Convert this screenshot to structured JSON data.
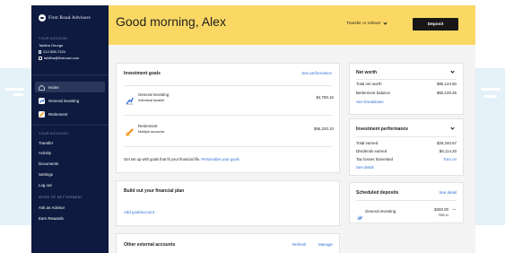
{
  "brand": {
    "name": "First Road Advisors"
  },
  "sidebar": {
    "advisor_heading": "YOUR ADVISOR",
    "advisor_name": "Tabitha George",
    "advisor_phone": "212-555-7224",
    "advisor_email": "tabitha@firstroad.com",
    "nav": [
      {
        "label": "Home"
      },
      {
        "label": "General investing"
      },
      {
        "label": "Retirement"
      }
    ],
    "account_heading": "YOUR ACCOUNT",
    "account_items": [
      "Transfer",
      "Activity",
      "Documents",
      "Settings",
      "Log out"
    ],
    "more_heading": "MORE OF BETTERMENT",
    "more_items": [
      "Ask an Advisor",
      "Earn Rewards"
    ]
  },
  "header": {
    "greeting": "Good morning, Alex",
    "transfer_label": "Transfer or rollover",
    "deposit_label": "Deposit"
  },
  "goals": {
    "title": "Investment goals",
    "link": "See performance",
    "items": [
      {
        "name": "General investing",
        "sub": "Individual taxable",
        "value": "$4,780.15"
      },
      {
        "name": "Retirement",
        "sub": "Multiple accounts",
        "value": "$55,320.10"
      }
    ],
    "footer_text": "Get set up with goals that fit your financial life.",
    "footer_link": "Personalize your goals"
  },
  "plan": {
    "title": "Build out your financial plan",
    "link": "Add goal/account"
  },
  "external": {
    "title": "Other external accounts",
    "refresh": "Refresh",
    "manage": "Manage"
  },
  "networth": {
    "title": "Net worth",
    "rows": [
      {
        "label": "Total net worth",
        "value": "$85,124.50"
      },
      {
        "label": "Betterment balance",
        "value": "$60,100.25"
      }
    ],
    "link": "See breakdown"
  },
  "performance": {
    "title": "Investment performance",
    "rows": [
      {
        "label": "Total earned",
        "value": "$26,340.67"
      },
      {
        "label": "Dividends earned",
        "value": "$8,114.20"
      },
      {
        "label": "Tax losses harvested",
        "value": "Turn on"
      }
    ],
    "link": "See detail"
  },
  "scheduled": {
    "title": "Scheduled deposits",
    "link": "See detail",
    "item": {
      "name": "General investing",
      "amount": "$300.00",
      "date": "FEB 11",
      "more": "..."
    }
  },
  "colors": {
    "header": "#fbd864",
    "sidebar": "#0e1a3f",
    "link": "#2f6fd6",
    "background_band": "#e4f1f9"
  }
}
